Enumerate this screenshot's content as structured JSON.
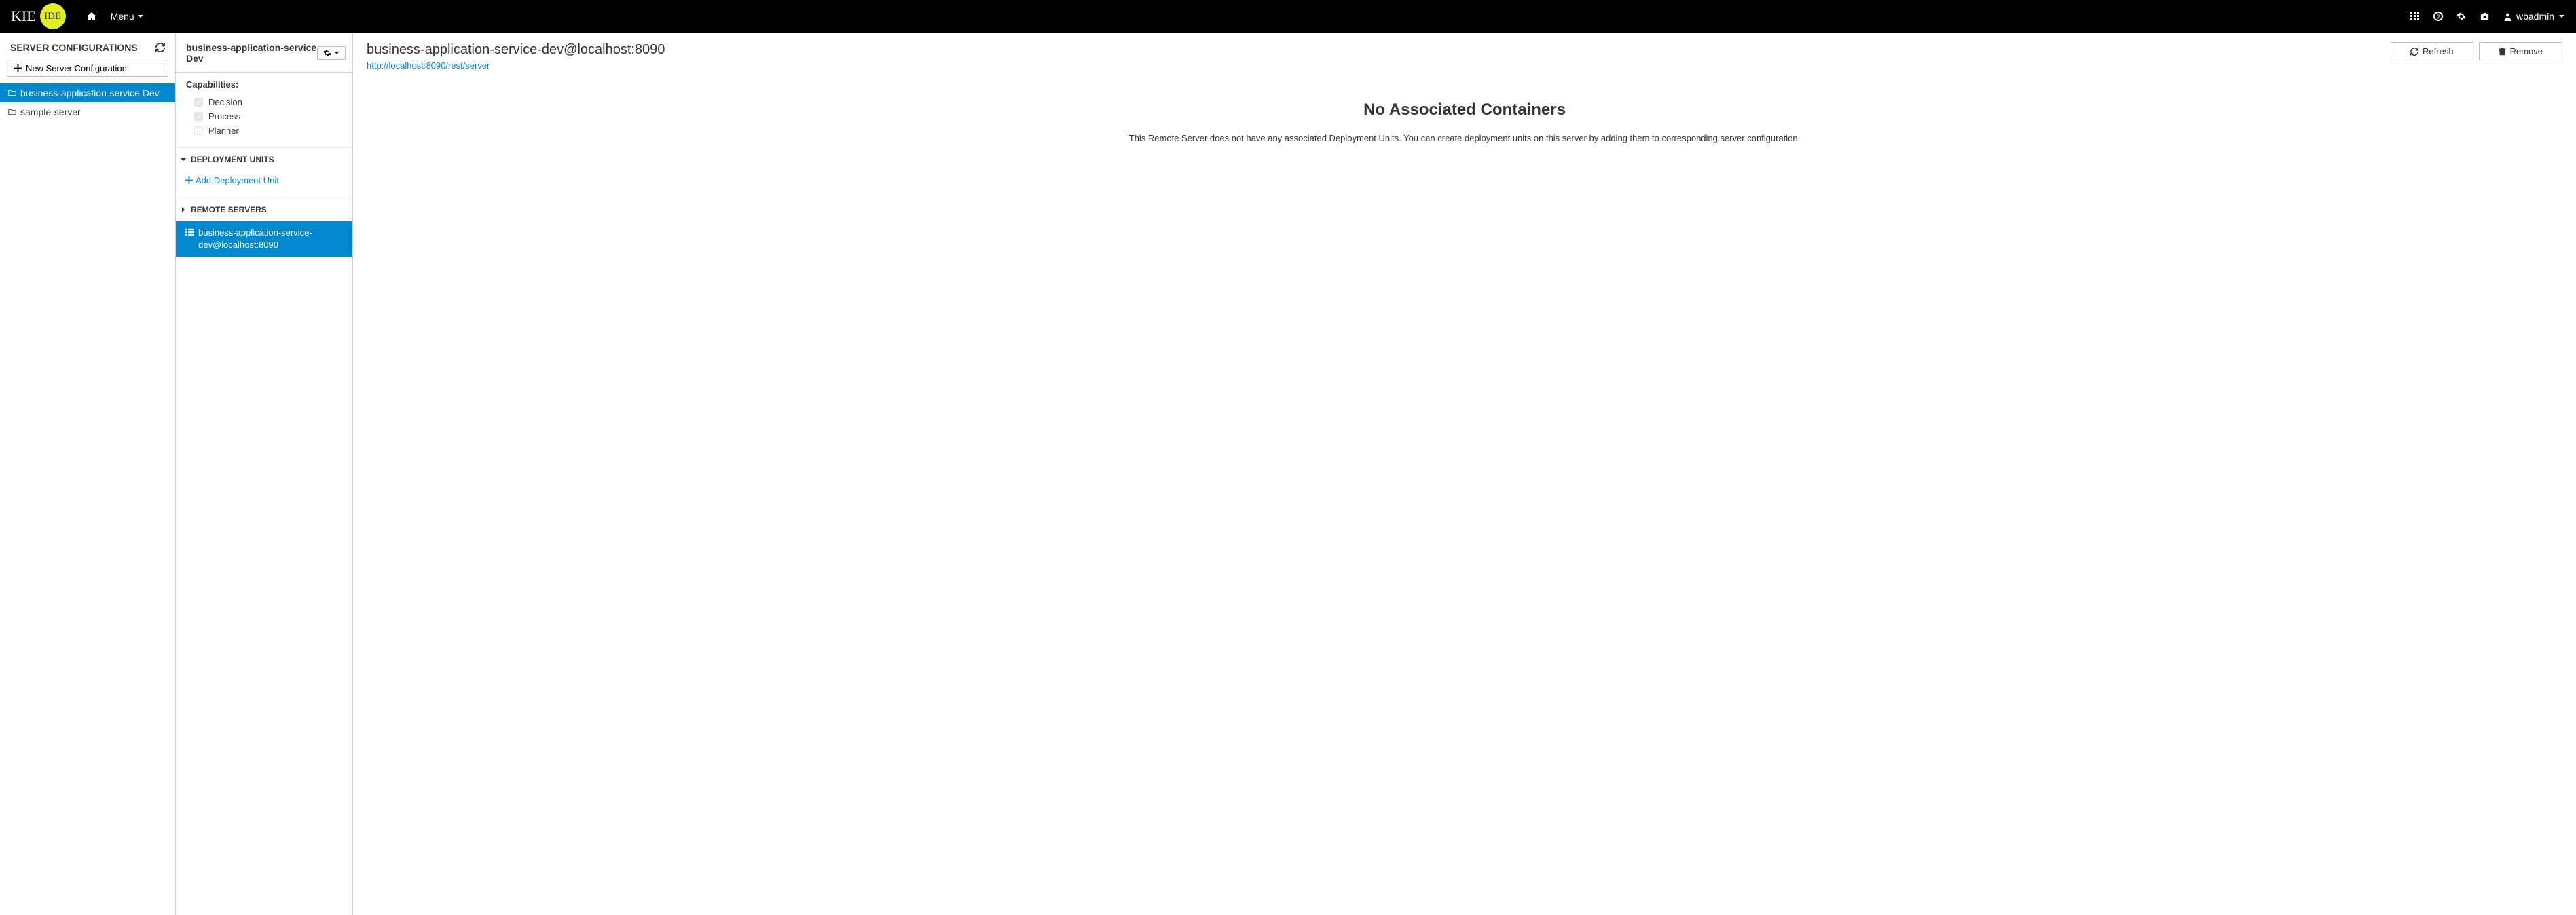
{
  "navbar": {
    "logo_kie": "KIE",
    "logo_ide": "IDE",
    "menu_label": "Menu",
    "username": "wbadmin"
  },
  "sidebar": {
    "title": "SERVER CONFIGURATIONS",
    "new_config_label": "New Server Configuration",
    "items": [
      {
        "label": "business-application-service Dev",
        "selected": true
      },
      {
        "label": "sample-server",
        "selected": false
      }
    ]
  },
  "details": {
    "title": "business-application-service Dev",
    "capabilities_label": "Capabilities:",
    "capabilities": [
      {
        "label": "Decision",
        "checked": true
      },
      {
        "label": "Process",
        "checked": true
      },
      {
        "label": "Planner",
        "checked": false
      }
    ],
    "deployment_units_label": "DEPLOYMENT UNITS",
    "add_deployment_label": "Add Deployment Unit",
    "remote_servers_label": "REMOTE SERVERS",
    "remote_servers": [
      {
        "label": "business-application-service-dev@localhost:8090"
      }
    ]
  },
  "content": {
    "title": "business-application-service-dev@localhost:8090",
    "url": "http://localhost:8090/rest/server",
    "refresh_label": "Refresh",
    "remove_label": "Remove",
    "empty_heading": "No Associated Containers",
    "empty_text": "This Remote Server does not have any associated Deployment Units. You can create deployment units on this server by adding them to corresponding server configuration."
  }
}
